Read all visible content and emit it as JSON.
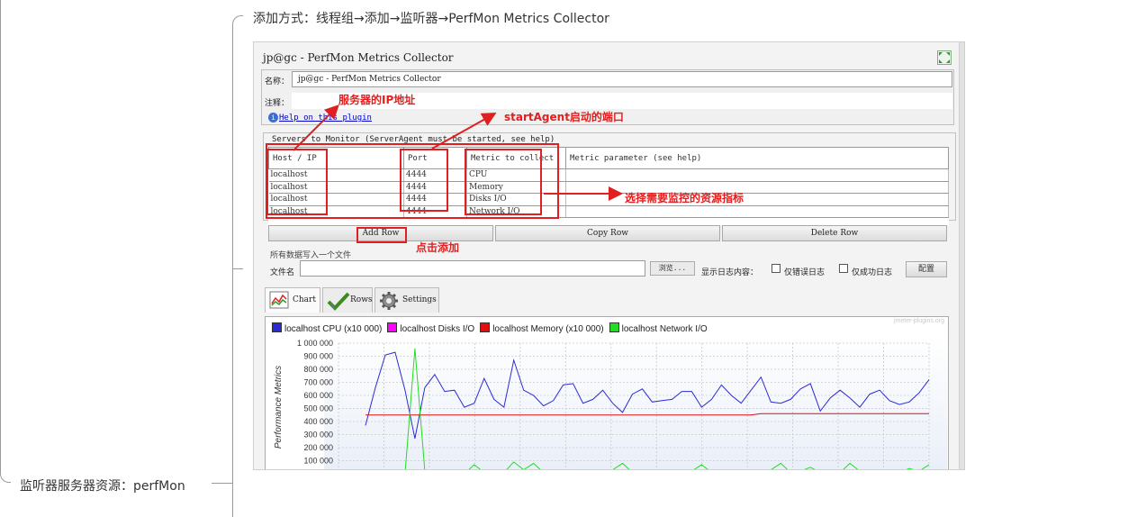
{
  "mindmap": {
    "top_node": "添加方式：线程组→添加→监听器→PerfMon Metrics Collector",
    "bottom_node": "监听器服务器资源：perfMon"
  },
  "window": {
    "title": "jp@gc - PerfMon Metrics Collector",
    "name_label": "名称：",
    "name_value": "jp@gc - PerfMon Metrics Collector",
    "comment_label": "注释：",
    "comment_value": "",
    "help_link": "Help on this plugin"
  },
  "servers": {
    "legend": "Servers to Monitor (ServerAgent must be started, see help)",
    "columns": [
      "Host / IP",
      "Port",
      "Metric to collect",
      "Metric parameter (see help)"
    ],
    "rows": [
      {
        "host": "localhost",
        "port": "4444",
        "metric": "CPU",
        "param": ""
      },
      {
        "host": "localhost",
        "port": "4444",
        "metric": "Memory",
        "param": ""
      },
      {
        "host": "localhost",
        "port": "4444",
        "metric": "Disks I/O",
        "param": ""
      },
      {
        "host": "localhost",
        "port": "4444",
        "metric": "Network I/O",
        "param": ""
      }
    ],
    "buttons": {
      "add": "Add Row",
      "copy": "Copy Row",
      "delete": "Delete Row"
    }
  },
  "file": {
    "legend": "所有数据写入一个文件",
    "label": "文件名",
    "value": "",
    "browse": "浏览...",
    "log_label": "显示日志内容：",
    "errors_only": "仅错误日志",
    "success_only": "仅成功日志",
    "errors_checked": false,
    "success_checked": false,
    "config": "配置"
  },
  "tabs": [
    {
      "label": "Chart",
      "active": true
    },
    {
      "label": "Rows",
      "active": false
    },
    {
      "label": "Settings",
      "active": false
    }
  ],
  "annotations": {
    "server_ip": "服务器的IP地址",
    "agent_port": "startAgent启动的端口",
    "select_metrics": "选择需要监控的资源指标",
    "click_add": "点击添加"
  },
  "colors": {
    "annotation": "#e02020",
    "cpu": "#2b2bd6",
    "disks": "#ff00ff",
    "memory": "#e01010",
    "network": "#22dd22"
  },
  "icons": [
    "expand-icon",
    "help-icon",
    "chart-icon",
    "checkmark-icon",
    "gear-icon"
  ],
  "chart_data": {
    "type": "line",
    "watermark": "jmeter-plugins.org",
    "ylabel": "Performance Metrics",
    "yticks": [
      "1 000 000",
      "900 000",
      "800 000",
      "700 000",
      "600 000",
      "500 000",
      "400 000",
      "300 000",
      "200 000",
      "100 000"
    ],
    "ylim": [
      0,
      1000000
    ],
    "grid": true,
    "legend_position": "top-left",
    "series": [
      {
        "name": "localhost CPU (x10 000)",
        "color": "#2b2bd6",
        "values": [
          370000,
          660000,
          910000,
          930000,
          640000,
          270000,
          660000,
          760000,
          630000,
          640000,
          510000,
          540000,
          730000,
          570000,
          510000,
          870000,
          640000,
          600000,
          520000,
          560000,
          680000,
          690000,
          540000,
          570000,
          640000,
          540000,
          470000,
          610000,
          650000,
          550000,
          560000,
          570000,
          630000,
          630000,
          510000,
          570000,
          680000,
          600000,
          540000,
          640000,
          740000,
          550000,
          540000,
          570000,
          650000,
          690000,
          480000,
          580000,
          640000,
          580000,
          510000,
          610000,
          640000,
          560000,
          530000,
          550000,
          620000,
          720000
        ]
      },
      {
        "name": "localhost Disks I/O",
        "color": "#ff00ff",
        "values": []
      },
      {
        "name": "localhost Memory (x10 000)",
        "color": "#e01010",
        "values": [
          450000,
          450000,
          450000,
          450000,
          450000,
          450000,
          450000,
          450000,
          450000,
          450000,
          450000,
          450000,
          450000,
          450000,
          450000,
          450000,
          450000,
          450000,
          450000,
          450000,
          450000,
          450000,
          450000,
          450000,
          450000,
          450000,
          450000,
          450000,
          450000,
          450000,
          450000,
          450000,
          450000,
          450000,
          450000,
          450000,
          450000,
          450000,
          450000,
          450000,
          460000,
          460000,
          460000,
          460000,
          460000,
          460000,
          460000,
          460000,
          460000,
          460000,
          460000,
          460000,
          460000,
          460000,
          460000,
          460000,
          460000,
          460000
        ]
      },
      {
        "name": "localhost Network I/O",
        "color": "#22dd22",
        "values": [
          0,
          0,
          0,
          0,
          0,
          960000,
          20000,
          30000,
          10000,
          20000,
          0,
          70000,
          10000,
          20000,
          10000,
          90000,
          30000,
          80000,
          10000,
          20000,
          30000,
          10000,
          0,
          20000,
          10000,
          30000,
          80000,
          10000,
          20000,
          10000,
          20000,
          0,
          10000,
          20000,
          70000,
          10000,
          20000,
          30000,
          10000,
          20000,
          10000,
          30000,
          80000,
          10000,
          20000,
          50000,
          10000,
          20000,
          10000,
          80000,
          20000,
          10000,
          20000,
          30000,
          10000,
          40000,
          20000,
          70000
        ]
      }
    ]
  }
}
